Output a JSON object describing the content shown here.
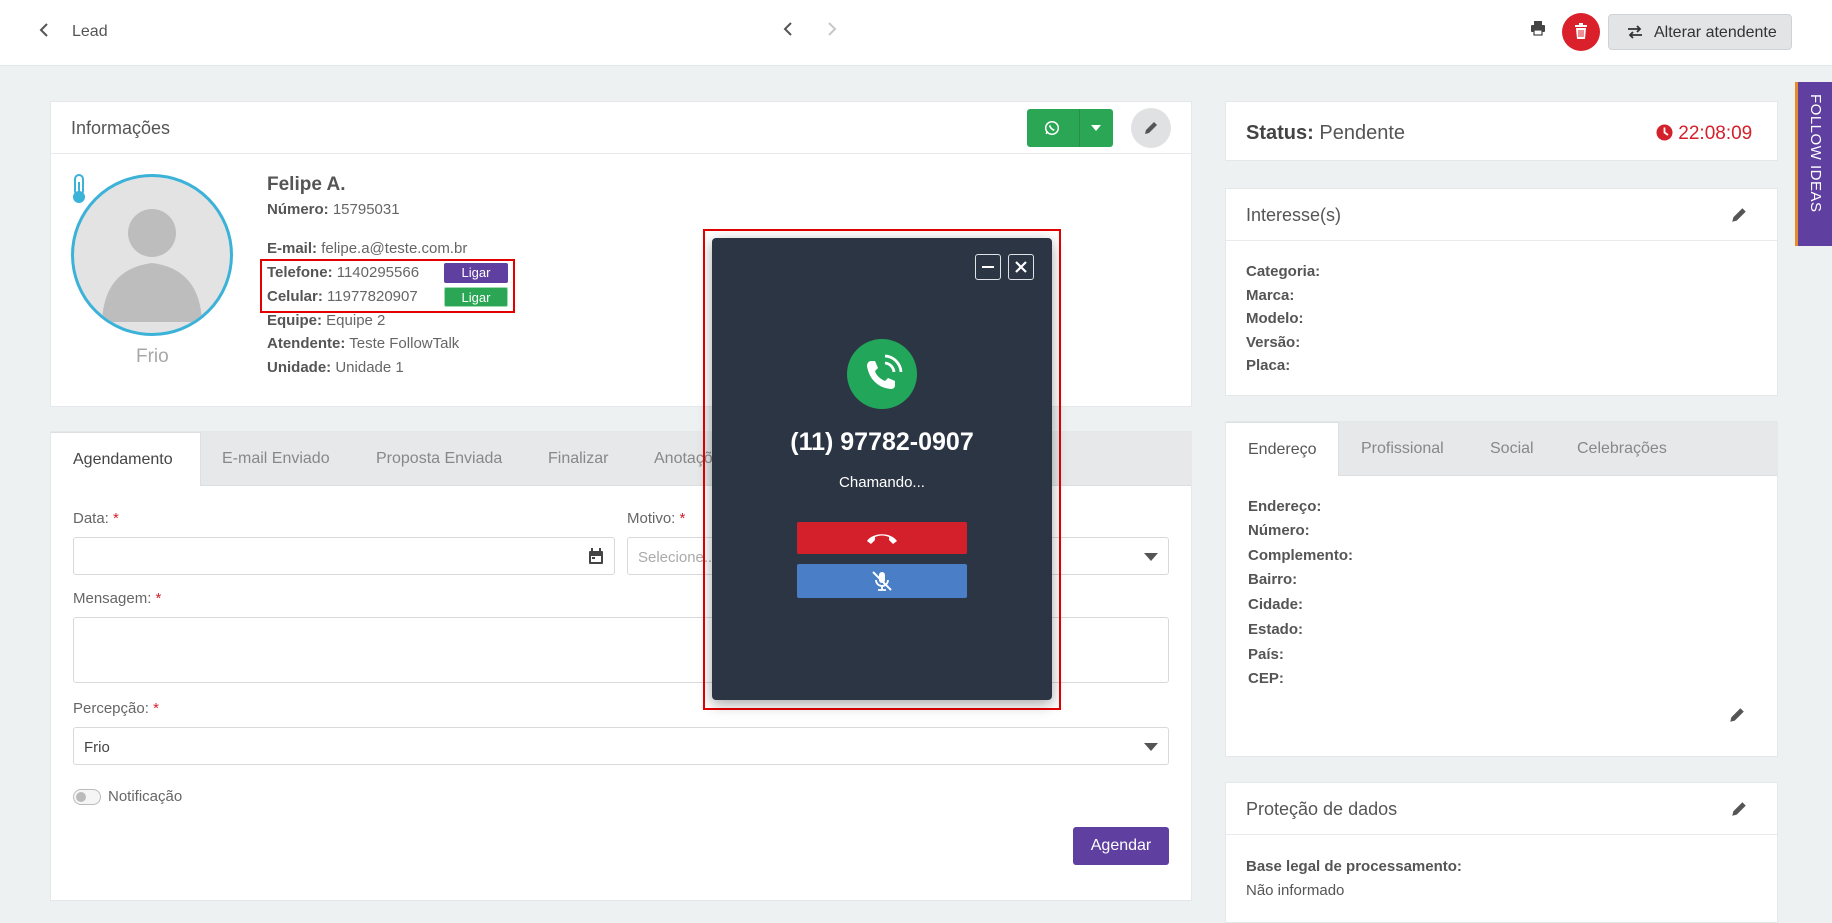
{
  "header": {
    "back_label": "Lead",
    "alterar_label": "Alterar atendente"
  },
  "info": {
    "title": "Informações",
    "temperature": "Frio",
    "name": "Felipe A.",
    "numero_label": "Número:",
    "numero_value": "15795031",
    "email_label": "E-mail:",
    "email_value": "felipe.a@teste.com.br",
    "telefone_label": "Telefone:",
    "telefone_value": "1140295566",
    "celular_label": "Celular:",
    "celular_value": "11977820907",
    "equipe_label": "Equipe:",
    "equipe_value": "Equipe 2",
    "atendente_label": "Atendente:",
    "atendente_value": "Teste FollowTalk",
    "unidade_label": "Unidade:",
    "unidade_value": "Unidade 1",
    "call_label": "Ligar"
  },
  "tabs": [
    "Agendamento",
    "E-mail Enviado",
    "Proposta Enviada",
    "Finalizar",
    "Anotações"
  ],
  "form": {
    "data_label": "Data:",
    "motivo_label": "Motivo:",
    "motivo_placeholder": "Selecione...",
    "mensagem_label": "Mensagem:",
    "percepcao_label": "Percepção:",
    "percepcao_value": "Frio",
    "required_mark": "*",
    "notificacao_label": "Notificação",
    "agendar_label": "Agendar"
  },
  "status": {
    "label": "Status:",
    "value": "Pendente",
    "timer": "22:08:09"
  },
  "interesses": {
    "title": "Interesse(s)",
    "fields": [
      "Categoria:",
      "Marca:",
      "Modelo:",
      "Versão:",
      "Placa:"
    ]
  },
  "endereco": {
    "tabs": [
      "Endereço",
      "Profissional",
      "Social",
      "Celebrações"
    ],
    "fields": [
      "Endereço:",
      "Número:",
      "Complemento:",
      "Bairro:",
      "Cidade:",
      "Estado:",
      "País:",
      "CEP:"
    ]
  },
  "protecao": {
    "title": "Proteção de dados",
    "base_label": "Base legal de processamento:",
    "base_value": "Não informado"
  },
  "side_tab": {
    "label": "FOLLOW IDEAS"
  },
  "call_popup": {
    "number": "(11) 97782-0907",
    "status": "Chamando..."
  },
  "colors": {
    "accent_purple": "#5f3f9f",
    "whatsapp_green": "#2aa654",
    "danger_red": "#d4202b",
    "popup_bg": "#2c3544",
    "mute_blue": "#4a7fc7"
  },
  "icons": [
    "chevron-left-icon",
    "chevron-right-icon",
    "printer-icon",
    "trash-icon",
    "swap-icon",
    "whatsapp-icon",
    "chevron-down-icon",
    "pencil-icon",
    "thermometer-icon",
    "user-icon",
    "calendar-icon",
    "clock-icon",
    "phone-ringing-icon",
    "hangup-icon",
    "mic-off-icon",
    "minimize-icon",
    "close-icon"
  ]
}
